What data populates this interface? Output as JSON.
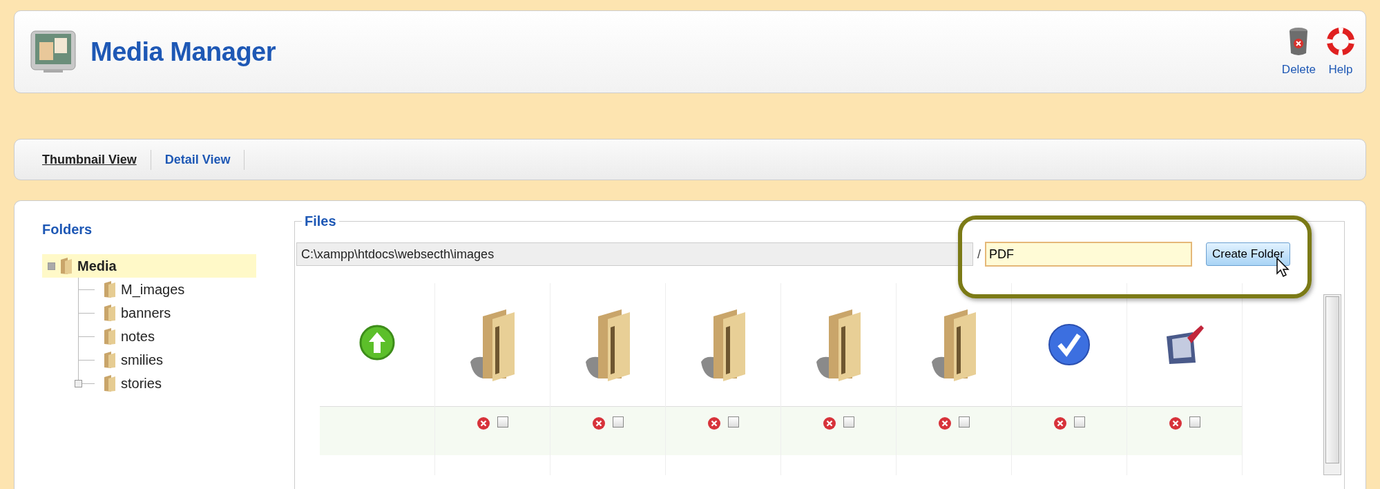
{
  "header": {
    "title": "Media Manager",
    "toolbar": [
      {
        "label": "Delete",
        "kind": "delete"
      },
      {
        "label": "Help",
        "kind": "help"
      }
    ]
  },
  "tabs": [
    {
      "label": "Thumbnail View",
      "selected": true
    },
    {
      "label": "Detail View",
      "selected": false
    }
  ],
  "folders": {
    "title": "Folders",
    "tree": [
      {
        "name": "Media",
        "selected": true,
        "expanded": true,
        "children": [
          {
            "name": "M_images",
            "selected": false
          },
          {
            "name": "banners",
            "selected": false
          },
          {
            "name": "notes",
            "selected": false
          },
          {
            "name": "smilies",
            "selected": false
          },
          {
            "name": "stories",
            "selected": false,
            "expanded": false
          }
        ]
      }
    ]
  },
  "files": {
    "title": "Files",
    "path": "C:\\xampp\\htdocs\\websecth\\images",
    "separator": "/",
    "new_folder": {
      "value": "PDF"
    },
    "create_button": "Create Folder",
    "items": [
      {
        "kind": "up"
      },
      {
        "kind": "folder",
        "checked": false
      },
      {
        "kind": "folder",
        "checked": false
      },
      {
        "kind": "folder",
        "checked": false
      },
      {
        "kind": "folder",
        "checked": false
      },
      {
        "kind": "folder",
        "checked": false
      },
      {
        "kind": "check",
        "checked": false
      },
      {
        "kind": "image",
        "checked": false
      }
    ]
  }
}
